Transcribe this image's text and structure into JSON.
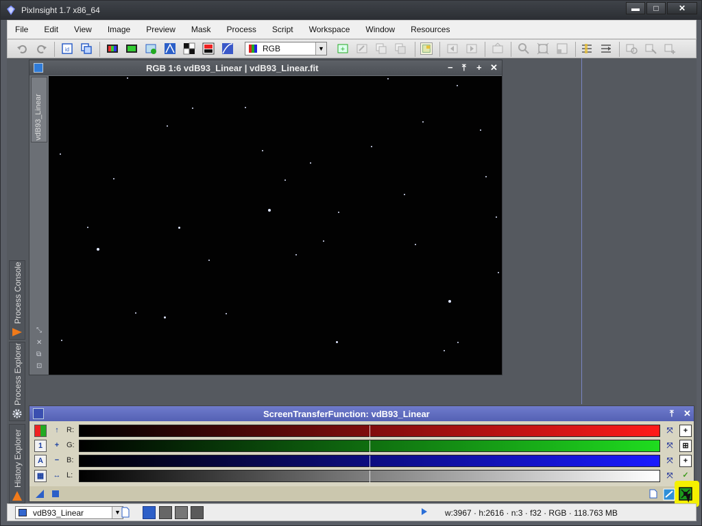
{
  "app": {
    "title": "PixInsight 1.7 x86_64",
    "window_buttons": [
      "▬",
      "□",
      "✕"
    ]
  },
  "menubar": {
    "items": [
      "File",
      "Edit",
      "View",
      "Image",
      "Preview",
      "Mask",
      "Process",
      "Script",
      "Workspace",
      "Window",
      "Resources"
    ]
  },
  "toolbar": {
    "channel_select": "RGB"
  },
  "side_tabs": {
    "process_console": "Process Console",
    "process_explorer": "Process Explorer",
    "history_explorer": "History Explorer"
  },
  "image_window": {
    "title": "RGB 1:6 vdB93_Linear | vdB93_Linear.fit",
    "view_tab": "vdB93_Linear",
    "controls": [
      "−",
      "⤒",
      "+",
      "✕"
    ]
  },
  "stf_panel": {
    "title": "ScreenTransferFunction: vdB93_Linear",
    "channels": [
      {
        "label": "R:",
        "color": "#ff1a1a"
      },
      {
        "label": "G:",
        "color": "#1fdc1f"
      },
      {
        "label": "B:",
        "color": "#1a1aff"
      },
      {
        "label": "L:",
        "color": "#ffffff"
      }
    ],
    "midtone_fraction": 0.5
  },
  "statusbar": {
    "view_select": "vdB93_Linear",
    "info": "w:3967 · h:2616 · n:3 · f32 · RGB · 118.763 MB"
  },
  "colors": {
    "accent": "#5461b4",
    "highlight": "#f4f000"
  }
}
